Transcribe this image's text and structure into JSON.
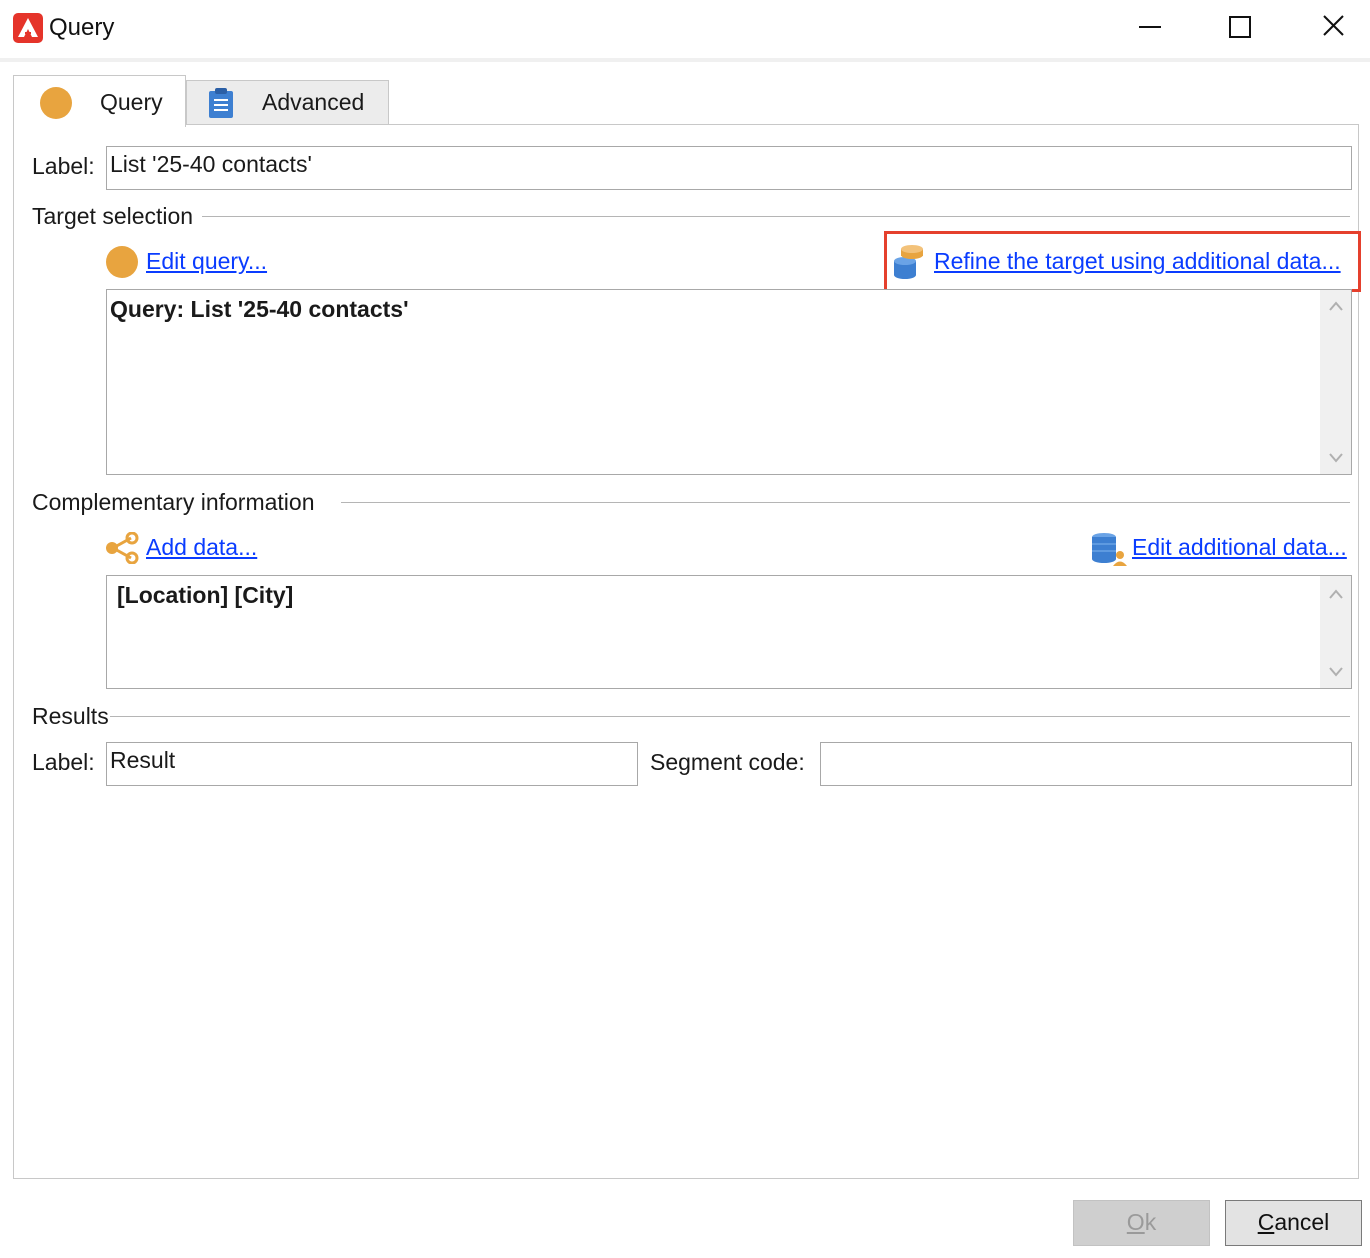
{
  "window": {
    "title": "Query"
  },
  "tabs": [
    {
      "label": "Query",
      "icon": "query-circle-icon",
      "active": true
    },
    {
      "label": "Advanced",
      "icon": "clipboard-icon",
      "active": false
    }
  ],
  "general": {
    "label_caption": "Label:",
    "label_value": "List '25-40 contacts'"
  },
  "target_selection": {
    "title": "Target selection",
    "edit_query_link": "Edit query...",
    "refine_link": "Refine the target using additional data...",
    "query_text": "Query: List '25-40 contacts'"
  },
  "complementary": {
    "title": "Complementary information",
    "add_data_link": "Add data...",
    "edit_additional_link": "Edit additional data...",
    "columns_text": "[Location]  [City]"
  },
  "results": {
    "title": "Results",
    "label_caption": "Label:",
    "label_value": "Result",
    "segment_caption": "Segment code:",
    "segment_value": ""
  },
  "buttons": {
    "ok_mnemonic": "O",
    "ok_rest": "k",
    "cancel_mnemonic": "C",
    "cancel_rest": "ancel"
  },
  "colors": {
    "accent_orange": "#e8a43f",
    "link_blue": "#0a3cff",
    "highlight_red": "#e5402d",
    "logo_red": "#e5342a"
  }
}
